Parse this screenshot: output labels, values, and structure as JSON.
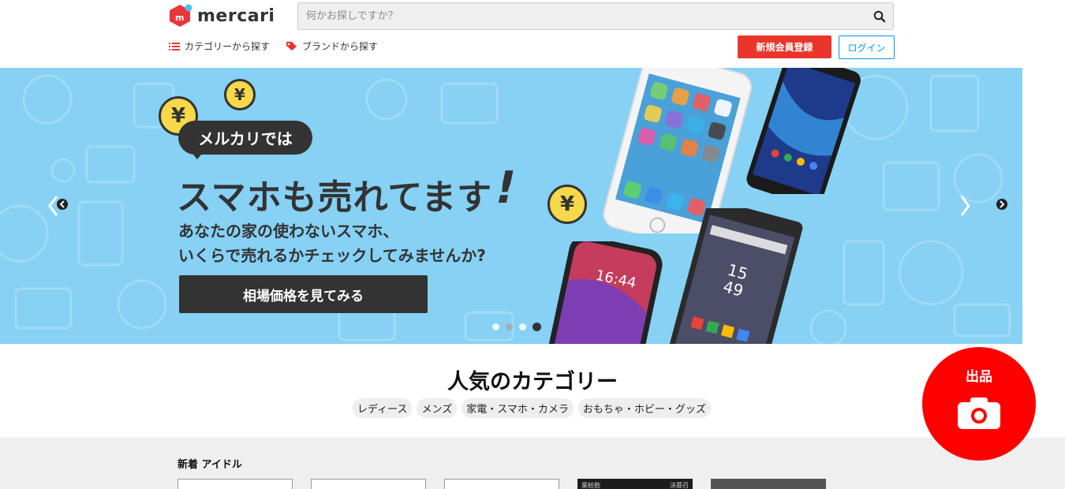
{
  "header": {
    "brand": "mercari",
    "search_placeholder": "何かお探しですか？",
    "nav": [
      {
        "label": "カテゴリーから探す",
        "icon": "list-icon"
      },
      {
        "label": "ブランドから探す",
        "icon": "tag-icon"
      }
    ],
    "register_label": "新規会員登録",
    "login_label": "ログイン"
  },
  "hero": {
    "bubble": "メルカリでは",
    "title": "スマホも売れてます",
    "exclaim": "!",
    "subline1": "あなたの家の使わないスマホ、",
    "subline2": "いくらで売れるかチェックしてみませんか?",
    "cta": "相場価格を見てみる",
    "yen_symbol": "¥",
    "phone_time_1": "16:44",
    "phone_time_2": "15",
    "phone_time_3": "49",
    "active_slide": 3,
    "slide_count": 4
  },
  "popular": {
    "title": "人気のカテゴリー",
    "tags": [
      "レディース",
      "メンズ",
      "家電・スマホ・カメラ",
      "おもちゃ・ホビー・グッズ"
    ]
  },
  "new_section": {
    "title": "新着 アイドル",
    "card4_text_left": "業給勘",
    "card4_text_right": "決募召"
  },
  "fab": {
    "label": "出品",
    "icon": "camera-icon"
  },
  "colors": {
    "accent_red": "#ea352d",
    "login_blue": "#0095ee",
    "hero_bg": "#86d1f4",
    "fab_red": "#ff0000"
  }
}
